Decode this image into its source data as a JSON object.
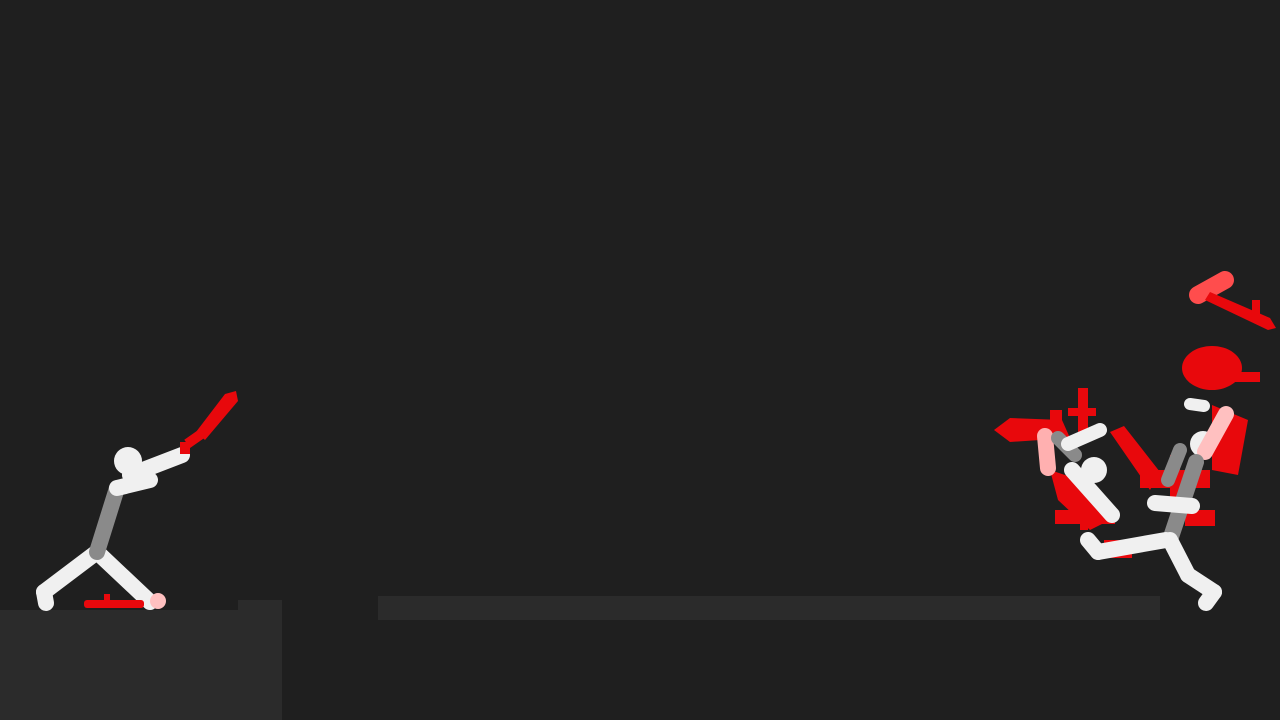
{
  "game": {
    "colors": {
      "background": "#1f1f1f",
      "platform": "#2b2b2b",
      "stickman": "#f0f0f0",
      "stickman_torso": "#8a8a8a",
      "weapon": "#e8080c",
      "weapon_light": "#ff4d4d"
    }
  }
}
